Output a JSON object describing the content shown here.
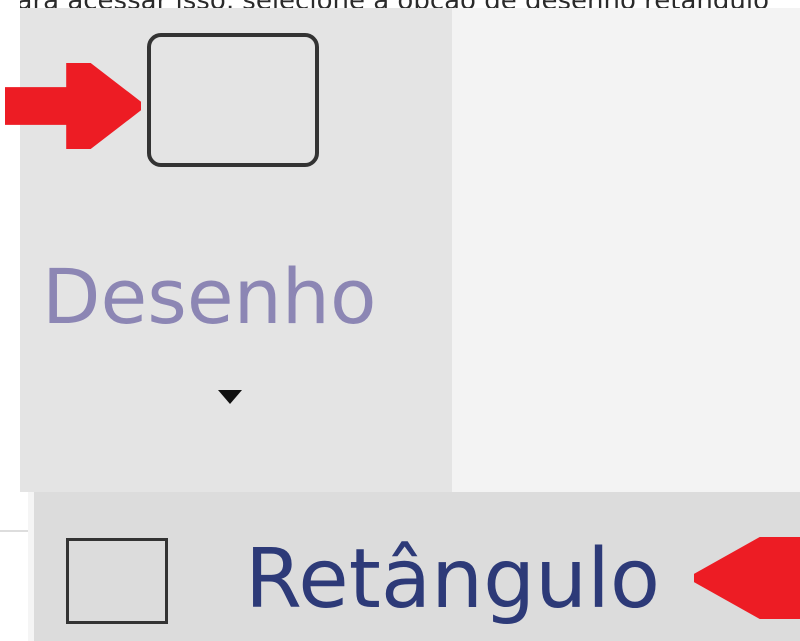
{
  "instruction_text": "Para acessar isso, selecione a opção de desenho retângulo",
  "ribbon": {
    "group_label": "Desenho",
    "shape_icon": "rounded-rectangle-icon",
    "dropdown_icon": "caret-down-icon"
  },
  "menu": {
    "item_label": "Retângulo",
    "item_icon": "rectangle-icon"
  },
  "colors": {
    "annotation_arrow": "#ed1c24",
    "ribbon_background": "#e4e4e4",
    "menu_background": "#dcdcdc",
    "group_label_text": "#8c86b4",
    "menu_label_text": "#2d3a78"
  }
}
